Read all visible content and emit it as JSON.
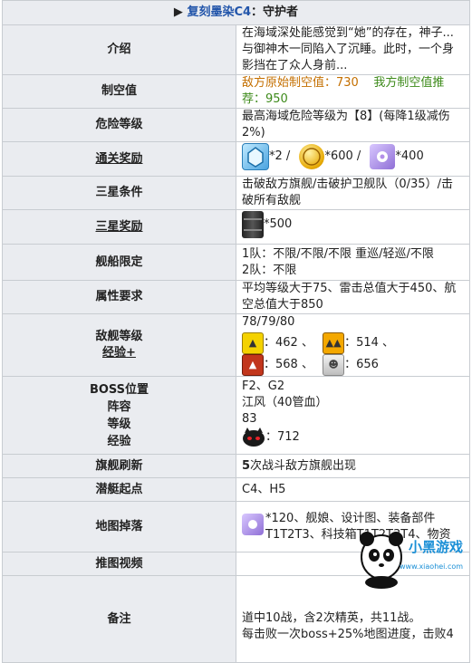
{
  "header": {
    "marker": "▶",
    "stage": "复刻墨染C4",
    "title": "：守护者"
  },
  "rows": {
    "intro": {
      "label": "介绍",
      "text": "在海域深处能感觉到“她”的存在，神子...与御神木一同陷入了沉睡。此时，一个身影挡在了众人身前..."
    },
    "air": {
      "label": "制空值",
      "enemy": "敌方原始制空值：730",
      "ours": "我方制空值推荐：950"
    },
    "danger": {
      "label": "危险等级",
      "text": "最高海域危险等级为【8】(每降1级减伤2%)"
    },
    "reward": {
      "label": "通关奖励",
      "a": "*2 /",
      "b": "*600 /",
      "c": "*400"
    },
    "star": {
      "label": "三星条件",
      "text": "击破敌方旗舰/击破护卫舰队（0/35）/击破所有敌舰"
    },
    "starreward": {
      "label": "三星奖励",
      "text": "*500"
    },
    "limit": {
      "label": "舰船限定",
      "l1": "1队：不限/不限/不限 重巡/轻巡/不限",
      "l2": "2队：不限"
    },
    "attr": {
      "label": "属性要求",
      "text": "平均等级大于75、雷击总值大于450、航空总值大于850"
    },
    "enemy": {
      "label1": "敌舰等级",
      "label2": "经验",
      "plus": "+",
      "levels": "78/79/80",
      "e1": "：462 、",
      "e2": "：514 、",
      "e3": "：568 、",
      "e4": "：656"
    },
    "boss": {
      "l1": "BOSS位置",
      "l2": "阵容",
      "l3": "等级",
      "l4": "经验",
      "pos": "F2、G2",
      "fleet": "江风（40管血）",
      "lv": "83",
      "exp": "：712"
    },
    "flag": {
      "label": "旗舰刷新",
      "num": "5",
      "text": "次战斗敌方旗舰出现"
    },
    "sub": {
      "label": "潜艇起点",
      "text": "C4、H5"
    },
    "drop": {
      "label": "地图掉落",
      "text": "*120、舰娘、设计图、装备部件T1T2T3、科技箱T1T2T3T4、物资"
    },
    "video": {
      "label": "推图视频",
      "text": ""
    },
    "note": {
      "label": "备注",
      "l1": "道中10战，含2次精英，共11战。",
      "l2": "每击败一次boss+25%地图进度，击败4"
    }
  },
  "watermark": {
    "name": "小黑游戏",
    "url": "www.xiaohei.com"
  }
}
